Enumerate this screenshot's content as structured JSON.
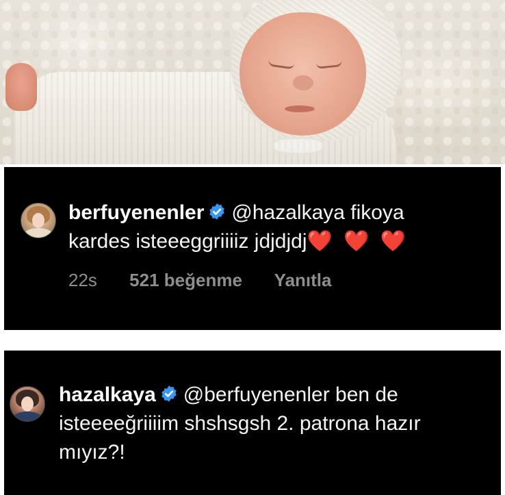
{
  "photo": {
    "alt_subject": ""
  },
  "comments": [
    {
      "username": "berfuyenenler",
      "verified": true,
      "mention": "@hazalkaya",
      "text_line1_rest": " fikoya",
      "text_line2": "kardes isteeeggriiiiz jdjdjdj",
      "emoji": "❤️ ❤️ ❤️",
      "time": "22s",
      "likes": "521 beğenme",
      "reply": "Yanıtla"
    },
    {
      "username": "hazalkaya",
      "verified": true,
      "mention": "@berfuyenenler",
      "text_line1_rest": " ben de",
      "text_line2": "isteeeeğriiiim shshsgsh 2. patrona hazır",
      "text_line3": "mıyız?!"
    }
  ],
  "colors": {
    "panel_bg": "#000000",
    "text": "#f5f5f5",
    "meta": "#8e8e8e",
    "verified_badge": "#3897f0",
    "heart": "#e0261f"
  }
}
